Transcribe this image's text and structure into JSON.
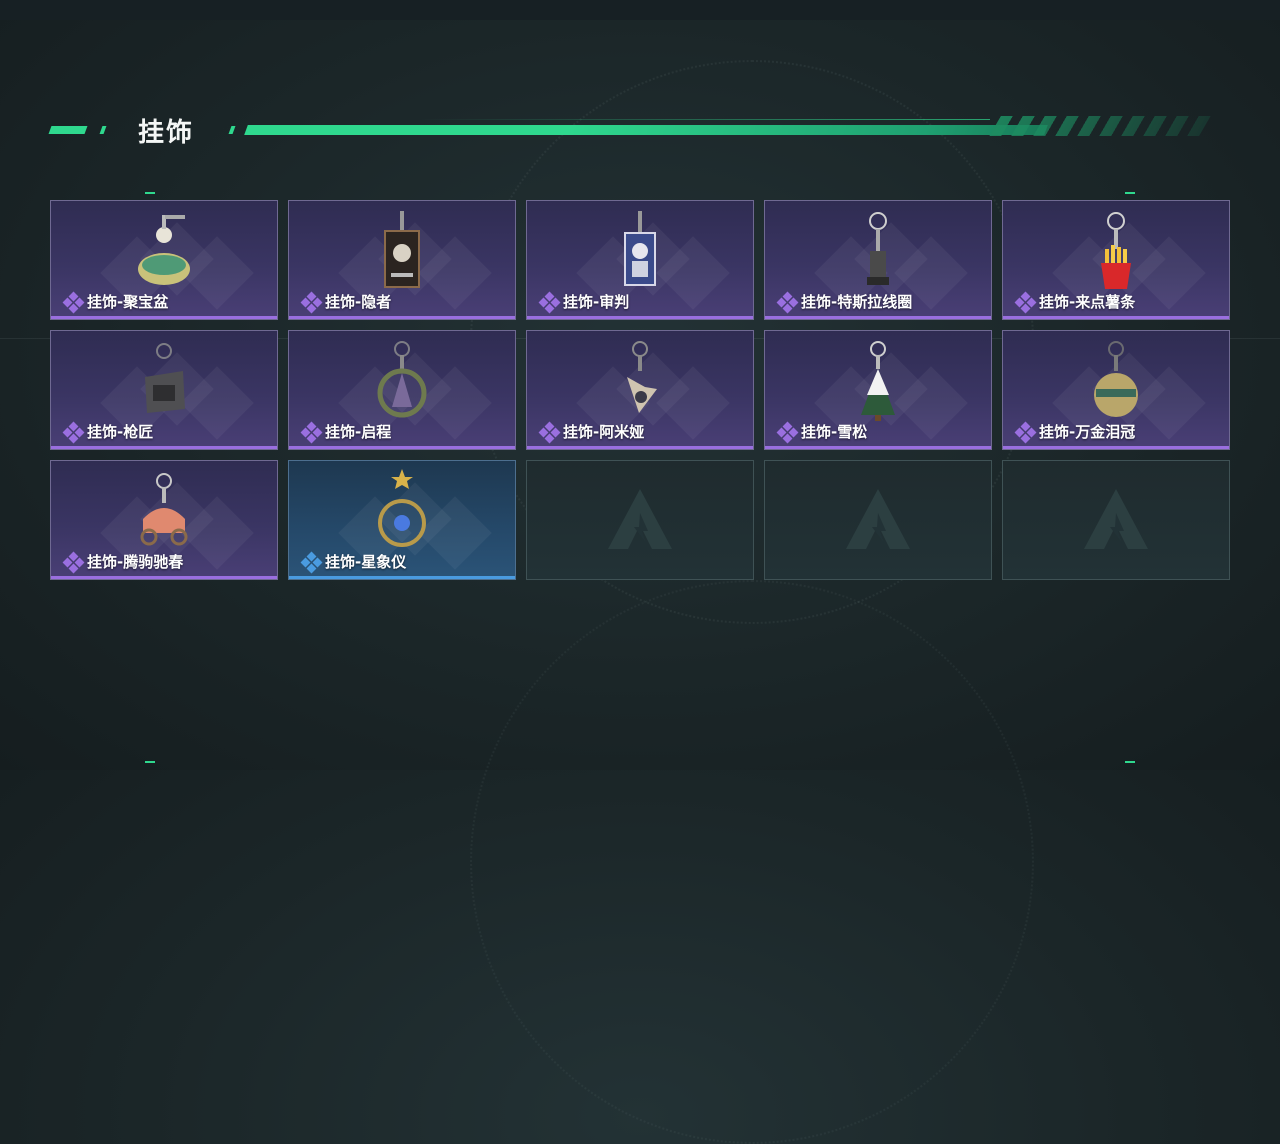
{
  "header": {
    "title": "挂饰"
  },
  "colors": {
    "accent": "#2fd88e",
    "purple_rarity": "#9a6fe0",
    "blue_rarity": "#4a9be0"
  },
  "items": [
    {
      "label": "挂饰-聚宝盆",
      "rarity": "purple",
      "icon": "treasure-bowl-charm-icon"
    },
    {
      "label": "挂饰-隐者",
      "rarity": "purple",
      "icon": "hermit-tarot-card-charm-icon"
    },
    {
      "label": "挂饰-审判",
      "rarity": "purple",
      "icon": "judgement-tarot-card-charm-icon"
    },
    {
      "label": "挂饰-特斯拉线圈",
      "rarity": "purple",
      "icon": "tesla-coil-charm-icon"
    },
    {
      "label": "挂饰-来点薯条",
      "rarity": "purple",
      "icon": "french-fries-charm-icon"
    },
    {
      "label": "挂饰-枪匠",
      "rarity": "purple",
      "icon": "gunsmith-charm-icon"
    },
    {
      "label": "挂饰-启程",
      "rarity": "purple",
      "icon": "departure-charm-icon"
    },
    {
      "label": "挂饰-阿米娅",
      "rarity": "purple",
      "icon": "amiya-charm-icon"
    },
    {
      "label": "挂饰-雪松",
      "rarity": "purple",
      "icon": "snowy-pine-charm-icon"
    },
    {
      "label": "挂饰-万金泪冠",
      "rarity": "purple",
      "icon": "golden-crown-charm-icon"
    },
    {
      "label": "挂饰-腾驹驰春",
      "rarity": "purple",
      "icon": "carriage-charm-icon"
    },
    {
      "label": "挂饰-星象仪",
      "rarity": "blue",
      "icon": "astrolabe-charm-icon"
    }
  ],
  "empty_slots": 3
}
